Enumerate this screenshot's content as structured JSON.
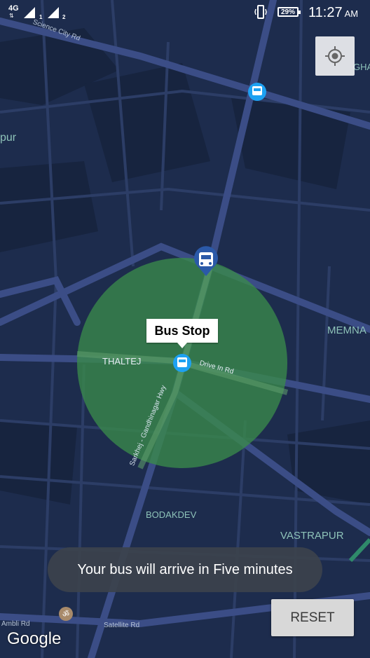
{
  "status_bar": {
    "network": "4G",
    "sim1": "1",
    "sim2": "2",
    "battery": "29%",
    "time": "11:27",
    "ampm": "AM"
  },
  "map": {
    "labels": {
      "science_city": "Science City Rd",
      "pur": "pur",
      "gha": "GHA",
      "thaltej": "THALTEJ",
      "drive_in": "Drive In Rd",
      "highway": "Sarkhej - Gandhinagar Hwy",
      "memna": "MEMNA",
      "bodakdev": "BODAKDEV",
      "vastrapur": "VASTRAPUR",
      "ambli": "Ambli Rd",
      "satellite": "Satellite Rd"
    },
    "geofence_color": "#3a8a4a",
    "bus_pin_color": "#2b59a8",
    "bus_icon_color": "#1da1f2"
  },
  "bubble": {
    "label": "Bus Stop"
  },
  "toast": {
    "message": "Your bus will arrive in Five minutes"
  },
  "reset_button": {
    "label": "RESET"
  },
  "attribution": {
    "google": "Google"
  }
}
